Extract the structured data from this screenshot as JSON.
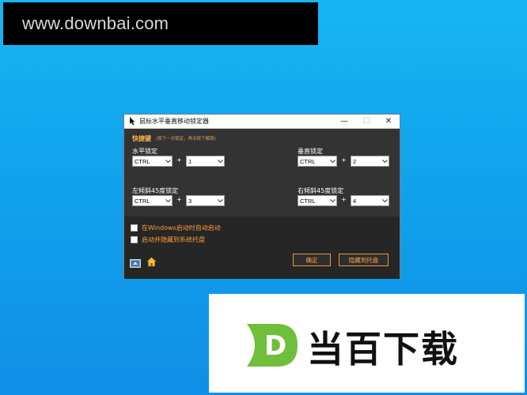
{
  "watermark_top": {
    "text": "www.downbai.com"
  },
  "window": {
    "title": "鼠标水平垂直移动锁定器",
    "controls": {
      "minimize": "—",
      "maximize": "☐",
      "close": "✕"
    }
  },
  "hotkeys": {
    "title": "快捷键",
    "note": "(按下一次锁定，再次按下解锁)",
    "groups": [
      {
        "label": "水平锁定",
        "modifier": "CTRL",
        "key": "1"
      },
      {
        "label": "垂直锁定",
        "modifier": "CTRL",
        "key": "2"
      },
      {
        "label": "左倾斜45度锁定",
        "modifier": "CTRL",
        "key": "3"
      },
      {
        "label": "右倾斜45度锁定",
        "modifier": "CTRL",
        "key": "4"
      }
    ],
    "plus": "+"
  },
  "options": {
    "autostart_label": "在Windows启动时自动启动",
    "hide_to_tray_label": "启动并隐藏到系统托盘",
    "autostart_checked": false,
    "hide_to_tray_checked": false
  },
  "buttons": {
    "ok": "确定",
    "hide_to_tray": "隐藏到托盘"
  },
  "watermark_bottom": {
    "text": "当百下载",
    "logo_letter": "D"
  },
  "colors": {
    "accent": "#ffa040",
    "dialog_bg": "#333333",
    "footer_bg": "#262626",
    "logo_green": "#6fbf3a"
  }
}
